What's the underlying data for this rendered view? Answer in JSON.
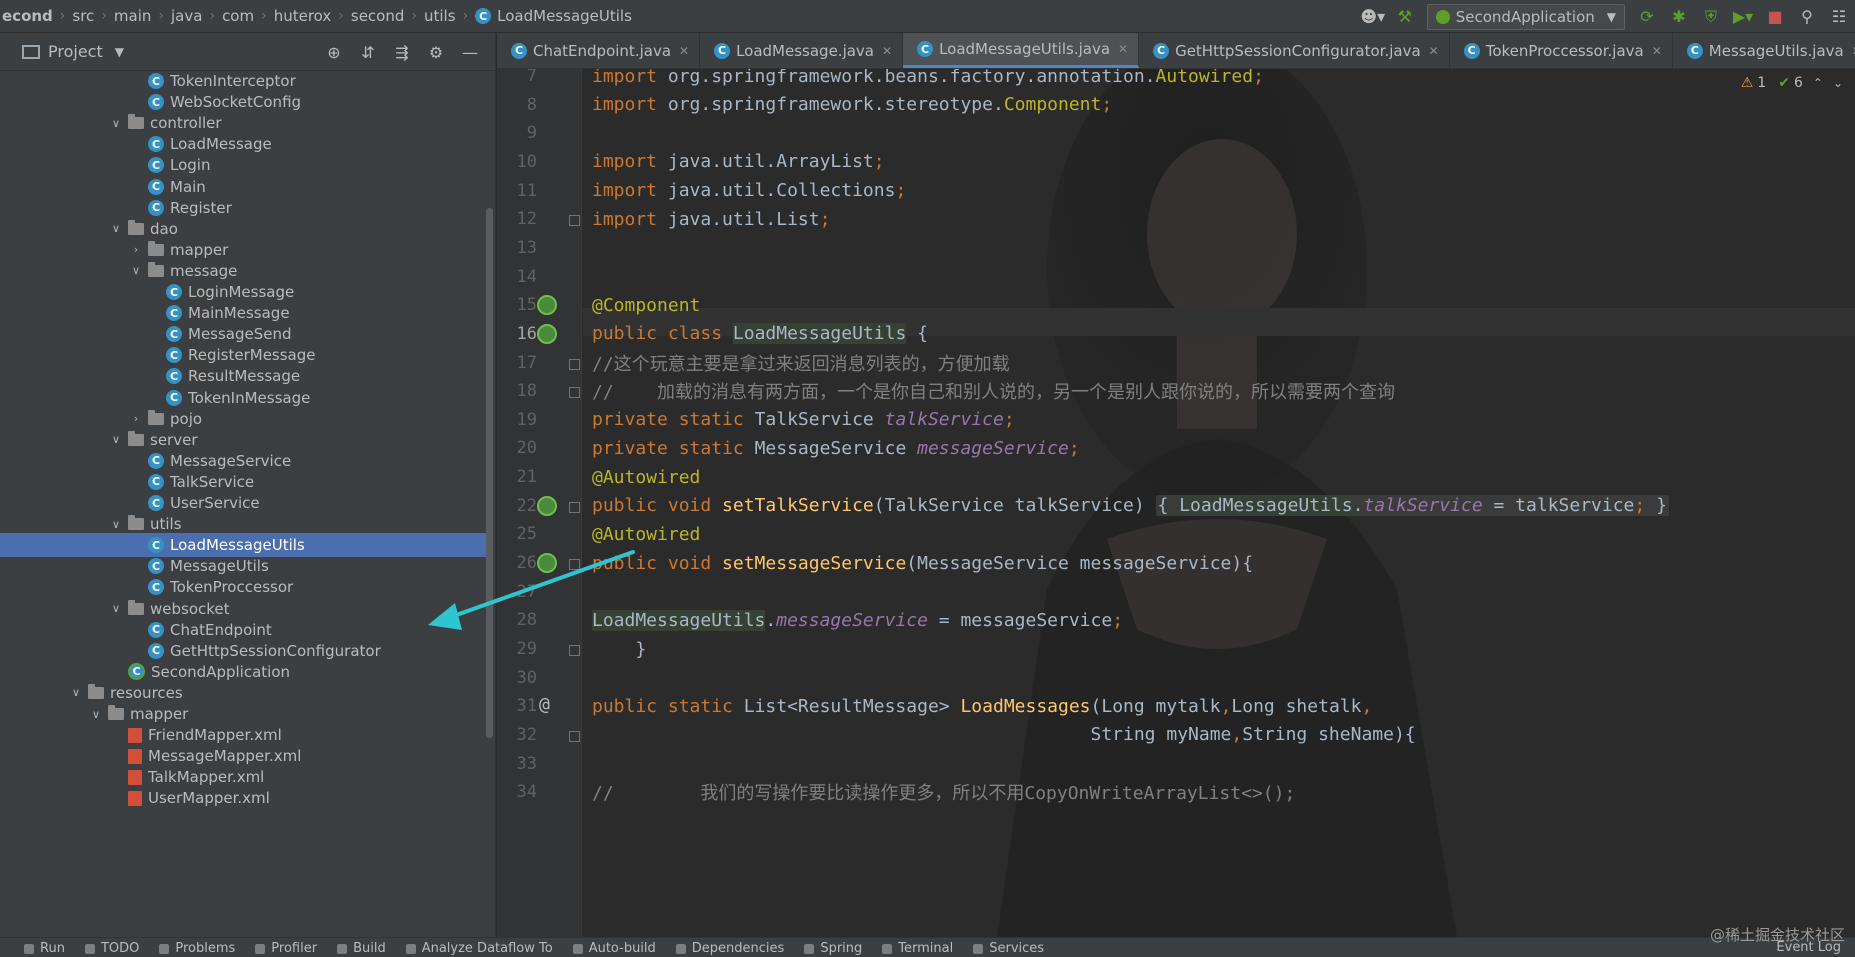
{
  "breadcrumbs": [
    "econd",
    "src",
    "main",
    "java",
    "com",
    "huterox",
    "second",
    "utils",
    "LoadMessageUtils"
  ],
  "run_config": "SecondApplication",
  "project_panel": {
    "title": "Project",
    "tree": [
      {
        "label": "TokenInterceptor",
        "type": "class",
        "depth": 3
      },
      {
        "label": "WebSocketConfig",
        "type": "class",
        "depth": 3
      },
      {
        "label": "controller",
        "type": "folder",
        "depth": 2,
        "expanded": true
      },
      {
        "label": "LoadMessage",
        "type": "class",
        "depth": 3
      },
      {
        "label": "Login",
        "type": "class",
        "depth": 3
      },
      {
        "label": "Main",
        "type": "class",
        "depth": 3
      },
      {
        "label": "Register",
        "type": "class",
        "depth": 3
      },
      {
        "label": "dao",
        "type": "folder",
        "depth": 2,
        "expanded": true
      },
      {
        "label": "mapper",
        "type": "folder",
        "depth": 3,
        "expanded": false
      },
      {
        "label": "message",
        "type": "folder",
        "depth": 3,
        "expanded": true
      },
      {
        "label": "LoginMessage",
        "type": "class",
        "depth": 4
      },
      {
        "label": "MainMessage",
        "type": "class",
        "depth": 4
      },
      {
        "label": "MessageSend",
        "type": "class",
        "depth": 4
      },
      {
        "label": "RegisterMessage",
        "type": "class",
        "depth": 4
      },
      {
        "label": "ResultMessage",
        "type": "class",
        "depth": 4
      },
      {
        "label": "TokenInMessage",
        "type": "class",
        "depth": 4
      },
      {
        "label": "pojo",
        "type": "folder",
        "depth": 3,
        "expanded": false
      },
      {
        "label": "server",
        "type": "folder",
        "depth": 2,
        "expanded": true
      },
      {
        "label": "MessageService",
        "type": "class",
        "depth": 3
      },
      {
        "label": "TalkService",
        "type": "class",
        "depth": 3
      },
      {
        "label": "UserService",
        "type": "class",
        "depth": 3
      },
      {
        "label": "utils",
        "type": "folder",
        "depth": 2,
        "expanded": true
      },
      {
        "label": "LoadMessageUtils",
        "type": "class",
        "depth": 3,
        "selected": true
      },
      {
        "label": "MessageUtils",
        "type": "class",
        "depth": 3
      },
      {
        "label": "TokenProccessor",
        "type": "class",
        "depth": 3
      },
      {
        "label": "websocket",
        "type": "folder",
        "depth": 2,
        "expanded": true
      },
      {
        "label": "ChatEndpoint",
        "type": "class",
        "depth": 3
      },
      {
        "label": "GetHttpSessionConfigurator",
        "type": "class",
        "depth": 3
      },
      {
        "label": "SecondApplication",
        "type": "app",
        "depth": 2
      },
      {
        "label": "resources",
        "type": "folder",
        "depth": 0,
        "expanded": true
      },
      {
        "label": "mapper",
        "type": "folder",
        "depth": 1,
        "expanded": true
      },
      {
        "label": "FriendMapper.xml",
        "type": "xml",
        "depth": 2
      },
      {
        "label": "MessageMapper.xml",
        "type": "xml",
        "depth": 2
      },
      {
        "label": "TalkMapper.xml",
        "type": "xml",
        "depth": 2
      },
      {
        "label": "UserMapper.xml",
        "type": "xml",
        "depth": 2
      }
    ]
  },
  "editor_tabs": [
    {
      "label": "ChatEndpoint.java",
      "active": false
    },
    {
      "label": "LoadMessage.java",
      "active": false
    },
    {
      "label": "LoadMessageUtils.java",
      "active": true
    },
    {
      "label": "GetHttpSessionConfigurator.java",
      "active": false
    },
    {
      "label": "TokenProccessor.java",
      "active": false
    },
    {
      "label": "MessageUtils.java",
      "active": false
    }
  ],
  "inspections": {
    "warnings": "1",
    "ok": "6"
  },
  "code_lines": [
    {
      "n": "7",
      "html": "<span class=\"kw\">import </span>org.springframework.beans.factory.annotation.<span class=\"ann\">Autowired</span><span class=\"kw\">;</span>"
    },
    {
      "n": "8",
      "html": "<span class=\"kw\">import </span>org.springframework.stereotype.<span class=\"ann\">Component</span><span class=\"kw\">;</span>"
    },
    {
      "n": "9",
      "html": ""
    },
    {
      "n": "10",
      "html": "<span class=\"kw\">import </span>java.util.ArrayList<span class=\"kw\">;</span>"
    },
    {
      "n": "11",
      "html": "<span class=\"kw\">import </span>java.util.Collections<span class=\"kw\">;</span>"
    },
    {
      "n": "12",
      "html": "<span class=\"kw\">import </span>java.util.List<span class=\"kw\">;</span>"
    },
    {
      "n": "13",
      "html": ""
    },
    {
      "n": "14",
      "html": ""
    },
    {
      "n": "15",
      "html": "<span class=\"ann\">@Component</span>"
    },
    {
      "n": "16",
      "html": "<span class=\"kw\">public class </span><span class=\"cls-hl\">LoadMessageUtils</span> {"
    },
    {
      "n": "17",
      "html": "    <span class=\"cm\">//这个玩意主要是拿过来返回消息列表的，方便加载</span>"
    },
    {
      "n": "18",
      "html": "<span class=\"cm\">//    加载的消息有两方面，一个是你自己和别人说的，另一个是别人跟你说的，所以需要两个查询</span>"
    },
    {
      "n": "19",
      "html": "    <span class=\"kw\">private static </span>TalkService <span class=\"field\">talkService</span><span class=\"kw\">;</span>"
    },
    {
      "n": "20",
      "html": "    <span class=\"kw\">private static </span>MessageService <span class=\"field\">messageService</span><span class=\"kw\">;</span>"
    },
    {
      "n": "21",
      "html": "    <span class=\"ann\">@Autowired</span>"
    },
    {
      "n": "22",
      "html": "    <span class=\"kw\">public void </span><span class=\"fn\">setTalkService</span>(TalkService talkService) <span class=\"fold-box\">{ <span class=\"cls-hl\">LoadMessageUtils</span>.<span class=\"field\">talkService</span> = talkService<span class=\"kw\">;</span> }</span>"
    },
    {
      "n": "25",
      "html": "    <span class=\"ann\">@Autowired</span>"
    },
    {
      "n": "26",
      "html": "    <span class=\"kw\">public void </span><span class=\"fn\">setMessageService</span>(MessageService messageService){"
    },
    {
      "n": "27",
      "html": ""
    },
    {
      "n": "28",
      "html": "        <span class=\"cls-hl\">LoadMessageUtils</span>.<span class=\"field\">messageService</span> = messageService<span class=\"kw\">;</span>"
    },
    {
      "n": "29",
      "html": "    }"
    },
    {
      "n": "30",
      "html": ""
    },
    {
      "n": "31",
      "html": "    <span class=\"kw\">public static </span>List&lt;ResultMessage&gt; <span class=\"fn\">LoadMessages</span>(Long mytalk<span class=\"kw\">,</span>Long shetalk<span class=\"kw\">,</span>"
    },
    {
      "n": "32",
      "html": "                                              String myName<span class=\"kw\">,</span>String sheName){"
    },
    {
      "n": "33",
      "html": ""
    },
    {
      "n": "34",
      "html": "<span class=\"cm\">//        我们的写操作要比读操作更多，所以不用CopyOnWriteArrayList&lt;&gt;();</span>"
    }
  ],
  "bottom_tabs": [
    "Run",
    "TODO",
    "Problems",
    "Profiler",
    "Build",
    "Analyze Dataflow To",
    "Auto-build",
    "Dependencies",
    "Spring",
    "Terminal",
    "Services"
  ],
  "event_log": "Event Log",
  "watermark": "@稀土掘金技术社区",
  "colors": {
    "selection": "#4b6eaf",
    "arrow": "#2ec4d0",
    "keyword": "#cc7832",
    "annotation": "#bbb529"
  }
}
